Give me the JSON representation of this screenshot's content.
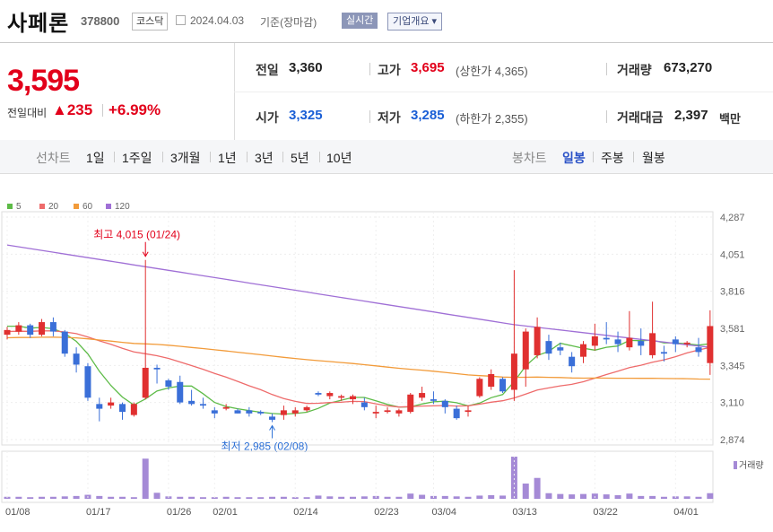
{
  "header": {
    "name": "사페론",
    "code": "378800",
    "market": "코스닥",
    "date": "2024.04.03",
    "basis": "기준(장마감)",
    "realtime": "실시간",
    "overview": "기업개요"
  },
  "summary": {
    "price": "3,595",
    "change_label": "전일대비",
    "change_value": "▲235",
    "change_pct": "+6.99%",
    "prev_label": "전일",
    "prev": "3,360",
    "high_label": "고가",
    "high": "3,695",
    "upper_limit": "(상한가 4,365)",
    "volume_label": "거래량",
    "volume": "673,270",
    "open_label": "시가",
    "open": "3,325",
    "low_label": "저가",
    "low": "3,285",
    "lower_limit": "(하한가 2,355)",
    "amount_label": "거래대금",
    "amount": "2,397",
    "amount_unit": "백만"
  },
  "nav": {
    "line_chart": "선차트",
    "periods": [
      "1일",
      "1주일",
      "3개월",
      "1년",
      "3년",
      "5년",
      "10년"
    ],
    "candle_chart": "봉차트",
    "candle_periods": [
      "일봉",
      "주봉",
      "월봉"
    ]
  },
  "colors": {
    "up": "#e03030",
    "down": "#3a6fd8",
    "ma5": "#5dbb47",
    "ma20": "#ee6b6b",
    "ma60": "#f29b3a",
    "ma120": "#a070d6",
    "volume": "#a58ad6"
  },
  "chart_data": {
    "type": "candlestick",
    "legend": [
      "5",
      "20",
      "60",
      "120"
    ],
    "ylim": [
      2874,
      4287
    ],
    "yticks": [
      "4,287",
      "4,051",
      "3,816",
      "3,581",
      "3,345",
      "3,110",
      "2,874"
    ],
    "ytick_values": [
      4287,
      4051,
      3816,
      3581,
      3345,
      3110,
      2874
    ],
    "xlabels": [
      {
        "i": 0,
        "label": "01/08"
      },
      {
        "i": 7,
        "label": "01/17"
      },
      {
        "i": 14,
        "label": "01/26"
      },
      {
        "i": 18,
        "label": "02/01"
      },
      {
        "i": 25,
        "label": "02/14"
      },
      {
        "i": 32,
        "label": "02/23"
      },
      {
        "i": 37,
        "label": "03/04"
      },
      {
        "i": 44,
        "label": "03/13"
      },
      {
        "i": 51,
        "label": "03/22"
      },
      {
        "i": 58,
        "label": "04/01"
      }
    ],
    "max_annotation": "최고 4,015 (01/24)",
    "max_index": 12,
    "max_value": 4015,
    "min_annotation": "최저 2,985 (02/08)",
    "min_index": 23,
    "min_value": 2985,
    "volume_label": "거래량",
    "candles": [
      {
        "o": 3540,
        "h": 3590,
        "l": 3510,
        "c": 3570
      },
      {
        "o": 3560,
        "h": 3620,
        "l": 3540,
        "c": 3600
      },
      {
        "o": 3600,
        "h": 3610,
        "l": 3520,
        "c": 3540
      },
      {
        "o": 3540,
        "h": 3640,
        "l": 3530,
        "c": 3620
      },
      {
        "o": 3620,
        "h": 3650,
        "l": 3530,
        "c": 3560
      },
      {
        "o": 3560,
        "h": 3570,
        "l": 3400,
        "c": 3420
      },
      {
        "o": 3420,
        "h": 3460,
        "l": 3300,
        "c": 3350
      },
      {
        "o": 3340,
        "h": 3360,
        "l": 3120,
        "c": 3140
      },
      {
        "o": 3100,
        "h": 3140,
        "l": 2990,
        "c": 3070
      },
      {
        "o": 3090,
        "h": 3140,
        "l": 3070,
        "c": 3110
      },
      {
        "o": 3100,
        "h": 3110,
        "l": 3000,
        "c": 3050
      },
      {
        "o": 3030,
        "h": 3110,
        "l": 3020,
        "c": 3100
      },
      {
        "o": 3140,
        "h": 4015,
        "l": 3130,
        "c": 3330
      },
      {
        "o": 3330,
        "h": 3350,
        "l": 3230,
        "c": 3320
      },
      {
        "o": 3250,
        "h": 3260,
        "l": 3190,
        "c": 3210
      },
      {
        "o": 3240,
        "h": 3280,
        "l": 3100,
        "c": 3110
      },
      {
        "o": 3120,
        "h": 3190,
        "l": 3090,
        "c": 3100
      },
      {
        "o": 3100,
        "h": 3140,
        "l": 3070,
        "c": 3090
      },
      {
        "o": 3060,
        "h": 3080,
        "l": 3010,
        "c": 3040
      },
      {
        "o": 3070,
        "h": 3100,
        "l": 3060,
        "c": 3080
      },
      {
        "o": 3060,
        "h": 3070,
        "l": 3040,
        "c": 3040
      },
      {
        "o": 3060,
        "h": 3080,
        "l": 3020,
        "c": 3040
      },
      {
        "o": 3050,
        "h": 3060,
        "l": 3030,
        "c": 3040
      },
      {
        "o": 3020,
        "h": 3040,
        "l": 2985,
        "c": 3000
      },
      {
        "o": 3030,
        "h": 3090,
        "l": 3000,
        "c": 3060
      },
      {
        "o": 3040,
        "h": 3080,
        "l": 3020,
        "c": 3060
      },
      {
        "o": 3060,
        "h": 3090,
        "l": 3050,
        "c": 3080
      },
      {
        "o": 3170,
        "h": 3180,
        "l": 3150,
        "c": 3160
      },
      {
        "o": 3150,
        "h": 3180,
        "l": 3130,
        "c": 3170
      },
      {
        "o": 3140,
        "h": 3160,
        "l": 3120,
        "c": 3150
      },
      {
        "o": 3130,
        "h": 3160,
        "l": 3100,
        "c": 3150
      },
      {
        "o": 3110,
        "h": 3140,
        "l": 3060,
        "c": 3080
      },
      {
        "o": 3040,
        "h": 3090,
        "l": 3010,
        "c": 3050
      },
      {
        "o": 3050,
        "h": 3080,
        "l": 3040,
        "c": 3060
      },
      {
        "o": 3040,
        "h": 3070,
        "l": 3020,
        "c": 3060
      },
      {
        "o": 3050,
        "h": 3170,
        "l": 3040,
        "c": 3160
      },
      {
        "o": 3140,
        "h": 3210,
        "l": 3120,
        "c": 3170
      },
      {
        "o": 3130,
        "h": 3180,
        "l": 3100,
        "c": 3120
      },
      {
        "o": 3120,
        "h": 3130,
        "l": 3040,
        "c": 3080
      },
      {
        "o": 3070,
        "h": 3090,
        "l": 3000,
        "c": 3010
      },
      {
        "o": 3050,
        "h": 3090,
        "l": 3020,
        "c": 3060
      },
      {
        "o": 3150,
        "h": 3270,
        "l": 3140,
        "c": 3260
      },
      {
        "o": 3210,
        "h": 3320,
        "l": 3190,
        "c": 3290
      },
      {
        "o": 3260,
        "h": 3270,
        "l": 3170,
        "c": 3180
      },
      {
        "o": 3190,
        "h": 3950,
        "l": 3120,
        "c": 3420
      },
      {
        "o": 3320,
        "h": 3580,
        "l": 3210,
        "c": 3560
      },
      {
        "o": 3410,
        "h": 3650,
        "l": 3390,
        "c": 3590
      },
      {
        "o": 3500,
        "h": 3540,
        "l": 3380,
        "c": 3420
      },
      {
        "o": 3460,
        "h": 3490,
        "l": 3410,
        "c": 3440
      },
      {
        "o": 3400,
        "h": 3430,
        "l": 3300,
        "c": 3340
      },
      {
        "o": 3400,
        "h": 3500,
        "l": 3360,
        "c": 3480
      },
      {
        "o": 3470,
        "h": 3610,
        "l": 3440,
        "c": 3530
      },
      {
        "o": 3520,
        "h": 3620,
        "l": 3480,
        "c": 3510
      },
      {
        "o": 3510,
        "h": 3560,
        "l": 3430,
        "c": 3480
      },
      {
        "o": 3460,
        "h": 3690,
        "l": 3440,
        "c": 3520
      },
      {
        "o": 3500,
        "h": 3580,
        "l": 3410,
        "c": 3470
      },
      {
        "o": 3410,
        "h": 3750,
        "l": 3390,
        "c": 3550
      },
      {
        "o": 3430,
        "h": 3470,
        "l": 3370,
        "c": 3420
      },
      {
        "o": 3510,
        "h": 3530,
        "l": 3430,
        "c": 3480
      },
      {
        "o": 3480,
        "h": 3500,
        "l": 3460,
        "c": 3490
      },
      {
        "o": 3460,
        "h": 3520,
        "l": 3400,
        "c": 3430
      },
      {
        "o": 3360,
        "h": 3695,
        "l": 3285,
        "c": 3595
      }
    ],
    "volumes": [
      0.05,
      0.05,
      0.04,
      0.05,
      0.05,
      0.06,
      0.07,
      0.1,
      0.07,
      0.05,
      0.05,
      0.04,
      1.0,
      0.15,
      0.06,
      0.05,
      0.05,
      0.04,
      0.04,
      0.05,
      0.04,
      0.04,
      0.04,
      0.05,
      0.05,
      0.04,
      0.04,
      0.08,
      0.06,
      0.05,
      0.05,
      0.06,
      0.07,
      0.05,
      0.05,
      0.13,
      0.1,
      0.07,
      0.07,
      0.06,
      0.05,
      0.08,
      0.09,
      0.08,
      1.05,
      0.38,
      0.52,
      0.14,
      0.12,
      0.11,
      0.12,
      0.13,
      0.11,
      0.09,
      0.13,
      0.07,
      0.07,
      0.05,
      0.06,
      0.06,
      0.05,
      0.14
    ]
  }
}
